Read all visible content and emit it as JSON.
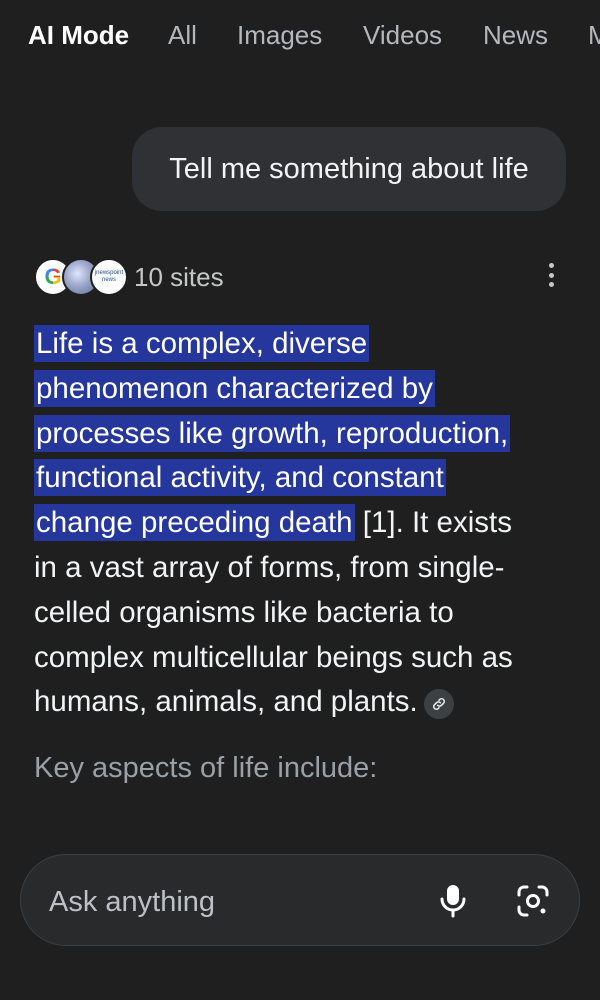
{
  "tabs": [
    "AI Mode",
    "All",
    "Images",
    "Videos",
    "News",
    "M"
  ],
  "user_message": "Tell me something about life",
  "sources": {
    "count_label": "10 sites",
    "favicons": [
      "google-icon",
      "globe-icon",
      "news-site-icon"
    ],
    "news_favicon_text": [
      "jnewspoint",
      "news"
    ]
  },
  "answer": {
    "highlighted_lines": [
      "Life is a complex, diverse",
      "phenomenon characterized by",
      "processes like growth, reproduction,",
      "functional activity, and constant",
      "change preceding death"
    ],
    "after_highlight_citation": " [1]. It exists",
    "body_lines": [
      "in a vast array of forms, from single-",
      "celled organisms like bacteria to",
      "complex multicellular beings such as",
      "humans, animals, and plants."
    ],
    "highlight_color": "#25369c"
  },
  "section_heading": "Key aspects of life include:",
  "ask_bar": {
    "placeholder": "Ask anything",
    "mic_icon": "microphone-icon",
    "camera_icon": "lens-camera-icon"
  }
}
